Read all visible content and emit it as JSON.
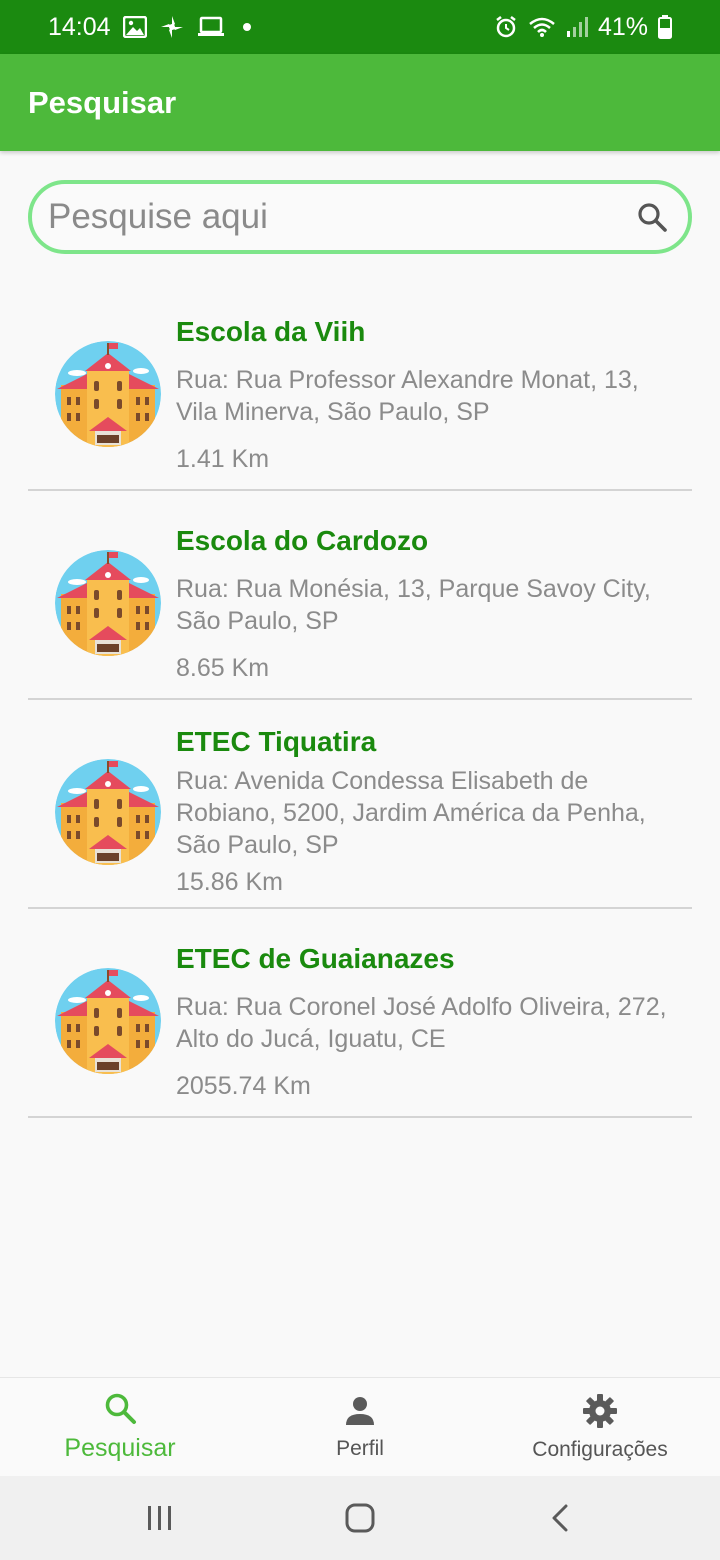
{
  "status": {
    "time": "14:04",
    "battery": "41%"
  },
  "app_bar": {
    "title": "Pesquisar"
  },
  "search": {
    "placeholder": "Pesquise aqui",
    "value": ""
  },
  "results": [
    {
      "name": "Escola da Viih",
      "address": "Rua: Rua Professor Alexandre Monat, 13, Vila Minerva, São Paulo, SP",
      "distance": "1.41 Km"
    },
    {
      "name": "Escola do Cardozo",
      "address": "Rua: Rua Monésia, 13, Parque Savoy City, São Paulo, SP",
      "distance": "8.65 Km"
    },
    {
      "name": "ETEC Tiquatira",
      "address": "Rua: Avenida Condessa Elisabeth de Robiano, 5200, Jardim América da Penha, São Paulo, SP",
      "distance": "15.86 Km"
    },
    {
      "name": "ETEC de Guaianazes",
      "address": "Rua: Rua Coronel José Adolfo Oliveira, 272, Alto do Jucá, Iguatu, CE",
      "distance": "2055.74 Km"
    }
  ],
  "bottom_nav": [
    {
      "label": "Pesquisar",
      "icon": "search-icon",
      "active": true
    },
    {
      "label": "Perfil",
      "icon": "person-icon",
      "active": false
    },
    {
      "label": "Configurações",
      "icon": "gear-icon",
      "active": false
    }
  ],
  "colors": {
    "status_bar": "#1b8a10",
    "app_bar": "#4db93b",
    "accent": "#4db93b",
    "title_green": "#1a8a0e",
    "search_border": "#7ee58a"
  }
}
